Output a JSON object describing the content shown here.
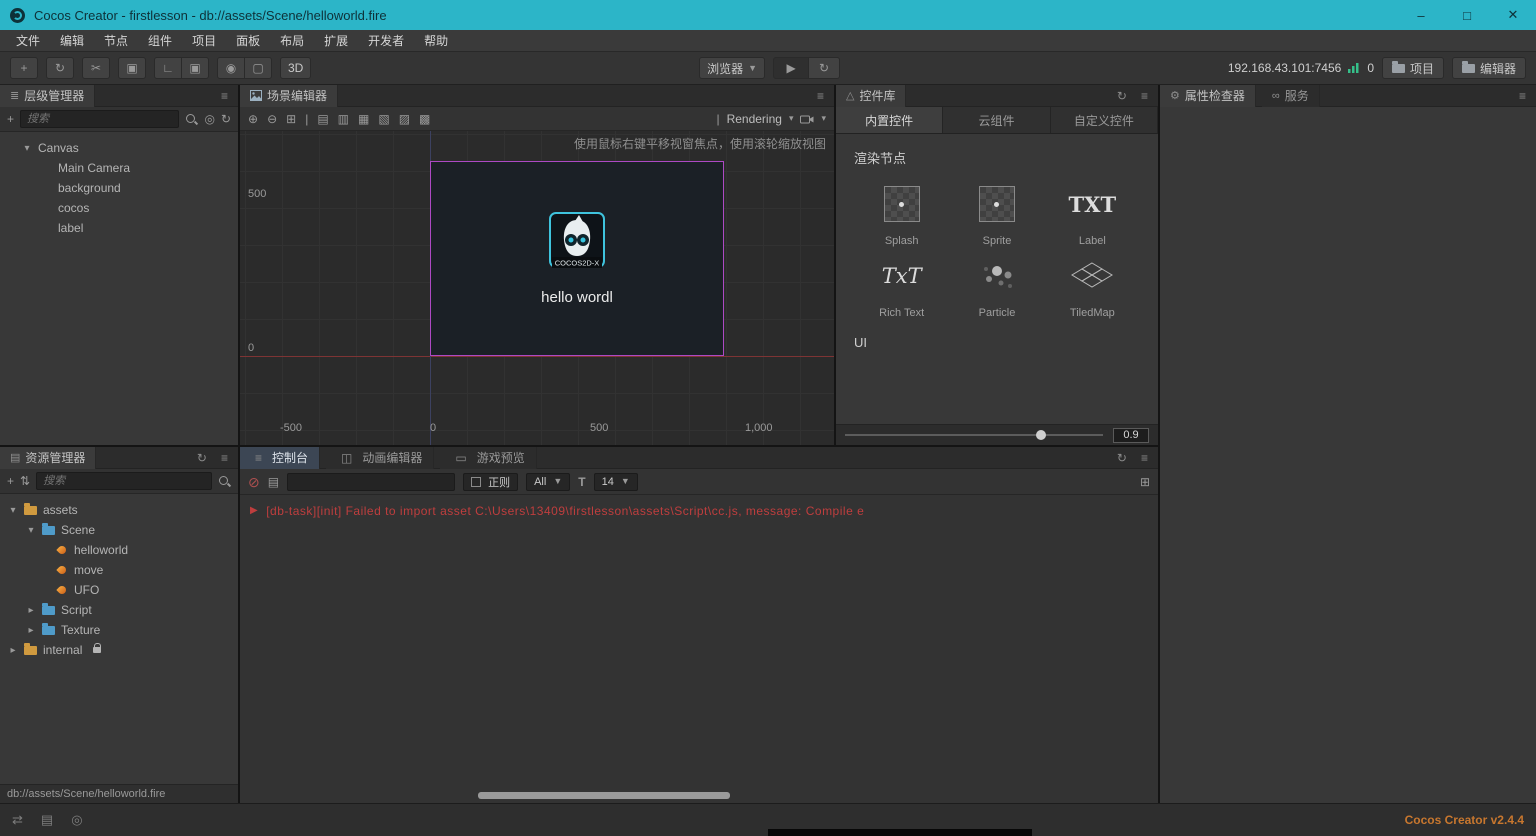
{
  "colors": {
    "titlebar": "#2cb5c8",
    "error_text": "#bf3e3e",
    "version_text": "#c8772e",
    "selection_outline": "#ad49c4",
    "folder_blue": "#4f9bc9",
    "asset_orange": "#d09a3f",
    "console_active_tab": "#3c4654"
  },
  "icons": {
    "minimize": "–",
    "maximize": "□",
    "close": "✕",
    "plus": "+",
    "sync": "↻",
    "cut": "✂",
    "frame": "▣",
    "tool_corner": "∟",
    "tool_box": "▣",
    "tool_dot": "◉",
    "tool_rect": "▢",
    "dropdown": "▼",
    "play": "▶",
    "menu": "≡",
    "hierarchy_panel": "≣",
    "assets_panel": "▤",
    "widgets_panel": "△",
    "gear": "⚙",
    "services": "∞",
    "caret_down": "▾",
    "caret_right": "▸",
    "crosshair": "◎",
    "sort": "⇅",
    "console_tab": "≡",
    "anim_tab": "◫",
    "preview_tab": "▭",
    "clear": "⊘",
    "doc": "▤",
    "grid": "⊞",
    "font_tool": "T",
    "divider": "|",
    "status_sync": "⇄",
    "status_list": "▤",
    "status_eye": "◎"
  },
  "titlebar": {
    "title": "Cocos Creator - firstlesson - db://assets/Scene/helloworld.fire"
  },
  "menubar": [
    "文件",
    "编辑",
    "节点",
    "组件",
    "项目",
    "面板",
    "布局",
    "扩展",
    "开发者",
    "帮助"
  ],
  "toolbar": {
    "mode_3d": "3D",
    "browser": "浏览器",
    "address": "192.168.43.101:7456",
    "counter": "0",
    "project": "项目",
    "editor": "编辑器"
  },
  "hierarchy": {
    "title": "层级管理器",
    "search_placeholder": "搜索",
    "tree": [
      {
        "label": "Canvas"
      },
      {
        "label": "Main Camera"
      },
      {
        "label": "background"
      },
      {
        "label": "cocos"
      },
      {
        "label": "label"
      }
    ]
  },
  "scene": {
    "tab": "场景编辑器",
    "toolbar_icons": [
      "⊕",
      "⊖",
      "⊞",
      "|",
      "▤",
      "▥",
      "▦",
      "▧",
      "▨",
      "▩",
      "|"
    ],
    "rendering": "Rendering",
    "hint": "使用鼠标右键平移视窗焦点，使用滚轮缩放视图",
    "ruler_y_500": "500",
    "ruler_y_0": "0",
    "ruler_x": [
      "-500",
      "0",
      "500",
      "1,000"
    ],
    "stage_text": "hello wordl",
    "logo_caption": "COCOS2D-X"
  },
  "widgets": {
    "title": "控件库",
    "tabs": [
      "内置控件",
      "云组件",
      "自定义控件"
    ],
    "section_render": "渲染节点",
    "items": [
      "Splash",
      "Sprite",
      "Label",
      "Rich Text",
      "Particle",
      "TiledMap"
    ],
    "label_glyph": "TXT",
    "richtext_glyph": "TxT",
    "section_ui": "UI",
    "zoom": "0.9"
  },
  "inspector": {
    "tab_properties": "属性检查器",
    "tab_services": "服务"
  },
  "assets": {
    "title": "资源管理器",
    "search_placeholder": "搜索",
    "tree": [
      {
        "label": "assets"
      },
      {
        "label": "Scene"
      },
      {
        "label": "helloworld"
      },
      {
        "label": "move"
      },
      {
        "label": "UFO"
      },
      {
        "label": "Script"
      },
      {
        "label": "Texture"
      },
      {
        "label": "internal"
      }
    ],
    "path": "db://assets/Scene/helloworld.fire"
  },
  "console": {
    "tabs": [
      "控制台",
      "动画编辑器",
      "游戏预览"
    ],
    "regex_label": "正则",
    "filter_value": "All",
    "font_size": "14",
    "error": "[db-task][init] Failed to import asset C:\\Users\\13409\\firstlesson\\assets\\Script\\cc.js, message: Compile e"
  },
  "statusbar": {
    "version": "Cocos Creator v2.4.4"
  }
}
